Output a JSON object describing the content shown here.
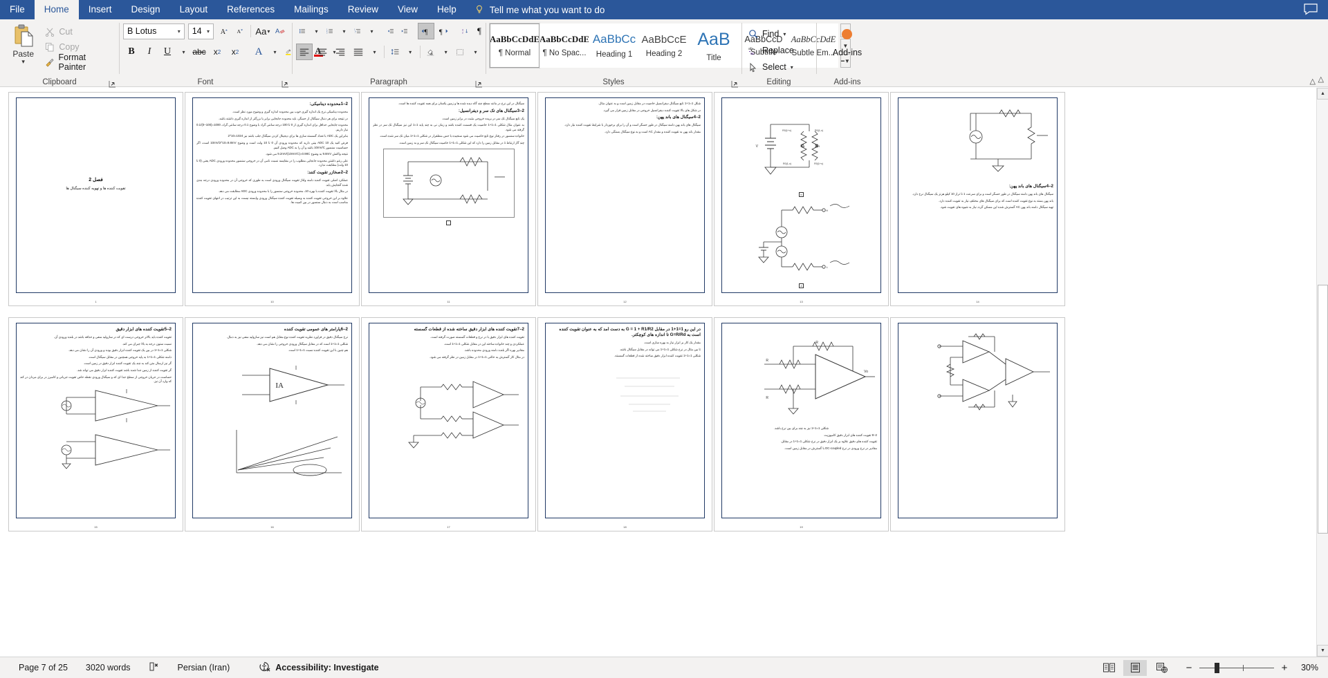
{
  "window": {
    "app": "Microsoft Word",
    "comments_icon": "comment-icon"
  },
  "tabs": [
    {
      "label": "File",
      "active": false
    },
    {
      "label": "Home",
      "active": true
    },
    {
      "label": "Insert",
      "active": false
    },
    {
      "label": "Design",
      "active": false
    },
    {
      "label": "Layout",
      "active": false
    },
    {
      "label": "References",
      "active": false
    },
    {
      "label": "Mailings",
      "active": false
    },
    {
      "label": "Review",
      "active": false
    },
    {
      "label": "View",
      "active": false
    },
    {
      "label": "Help",
      "active": false
    }
  ],
  "tellme": {
    "label": "Tell me what you want to do",
    "icon": "lightbulb-icon"
  },
  "ribbon": {
    "clipboard": {
      "label": "Clipboard",
      "paste": "Paste",
      "cut": "Cut",
      "copy": "Copy",
      "format_painter": "Format Painter"
    },
    "font": {
      "label": "Font",
      "font_name": "B Lotus",
      "font_size": "14",
      "grow_font": "grow-font-icon",
      "shrink_font": "shrink-font-icon",
      "change_case": "Aa",
      "clear_formatting": "clear-formatting-icon",
      "bold": "B",
      "italic": "I",
      "underline": "U",
      "strikethrough": "abc",
      "subscript": "x",
      "superscript": "x",
      "text_effects": "A",
      "highlight": "highlight-icon",
      "font_color": "A"
    },
    "paragraph": {
      "label": "Paragraph",
      "bullets": "bullets-icon",
      "numbering": "numbering-icon",
      "multilevel": "multilevel-list-icon",
      "decrease_indent": "decrease-indent-icon",
      "increase_indent": "increase-indent-icon",
      "ltr": "left-to-right-icon",
      "rtl": "right-to-left-icon",
      "sort": "sort-icon",
      "show_marks": "pilcrow-icon",
      "align_left": "align-left-icon",
      "align_center": "align-center-icon",
      "align_right": "align-right-icon",
      "justify": "justify-icon",
      "line_spacing": "line-spacing-icon",
      "shading": "shading-icon",
      "borders": "borders-icon"
    },
    "styles": {
      "label": "Styles",
      "items": [
        {
          "preview": "AaBbCcDdE",
          "name": "¶ Normal",
          "selected": true,
          "kind": "normal"
        },
        {
          "preview": "AaBbCcDdE",
          "name": "¶ No Spac...",
          "selected": false,
          "kind": "normal"
        },
        {
          "preview": "AaBbCc",
          "name": "Heading 1",
          "selected": false,
          "kind": "h"
        },
        {
          "preview": "AaBbCcE",
          "name": "Heading 2",
          "selected": false,
          "kind": "h"
        },
        {
          "preview": "AaB",
          "name": "Title",
          "selected": false,
          "kind": "title"
        },
        {
          "preview": "AaBbCcD",
          "name": "Subtitle",
          "selected": false,
          "kind": "sub"
        },
        {
          "preview": "AaBbCcDdE",
          "name": "Subtle Em...",
          "selected": false,
          "kind": "em"
        }
      ]
    },
    "editing": {
      "label": "Editing",
      "find": "Find",
      "replace": "Replace",
      "select": "Select"
    },
    "addins": {
      "label": "Add-ins",
      "button": "Add-ins"
    },
    "collapse": "collapse-ribbon-icon"
  },
  "statusbar": {
    "page": "Page 7 of 25",
    "words": "3020 words",
    "proofing_icon": "proofing-errors-icon",
    "language": "Persian (Iran)",
    "accessibility_icon": "accessibility-icon",
    "accessibility": "Accessibility: Investigate",
    "view_read": "read-mode-icon",
    "view_print": "print-layout-icon",
    "view_web": "web-layout-icon",
    "zoom_out": "−",
    "zoom_in": "+",
    "zoom_value": "30%"
  },
  "document": {
    "zoom_percent": 30,
    "pages": [
      {
        "number": "1",
        "kind": "cover",
        "title": "فصل 2",
        "subtitle": "تقویت کننده ها و تهویه کننده سیگنال ها"
      },
      {
        "number": "10",
        "kind": "text",
        "blocks": [
          {
            "type": "heading",
            "text": "2–1محدوده دینامیکی:"
          },
          {
            "type": "para",
            "text": "محدوده دینامیکی نرخ یک اندازه گیری خوب بین محدوده اندازه گیری و وضوح مورد نظر است."
          },
          {
            "type": "para",
            "text": "در نتیجه برای هر دنبال سیگنال از حسگر، باید محدوده جابجایی برابر یا بزرگتر از اندازه گیری داشته باشد."
          },
          {
            "type": "para",
            "text": "محدوده جابجایی حداقل برای اندازه گیری از 0 تا 100 درجه سانتی گراد با وضوح 0.1 درجه سانتی گراد، 1000=(100–0)/0.1 نیاز داریم."
          },
          {
            "type": "para",
            "text": "بنابراین یک ADC با تعداد گسسته سازی ها برای دیجیتال کردن سیگنال جلب باشد نیز 1024=10^2"
          },
          {
            "type": "para",
            "text": "فرض کنید یک ADC 10 بیتی دارید که محدوده ورودی آن 0 تا 10 ولت است و وضوح 10mV/2^10=9.8mV است، اگر حساسیت سنسور 10mV/C باشد و آن را به ADC وصل کنیم."
          },
          {
            "type": "para",
            "text": "نتیجه واکنش 9.8mV به وضوح 9.2mV/(10mV/C)=0.98C می شود."
          },
          {
            "type": "para",
            "text": "علی رغم داشتن محدوده جابجایی مطلوب را در مقایسه نسبت نامی آن در خروجی سنسور محدوده ورودی ADC یعنی (0 تا 10 ولت) مطابقت ندارد."
          },
          {
            "type": "heading",
            "text": "2–2صخازر تقویت کنند:"
          },
          {
            "type": "para",
            "text": "عملکرد اصلی تقویت کننده دامنه ولتاژ تقویت سیگنال ورودی است به طوری که خروجی آن در محدوده ورودی درجه بندی شده گنجایش یابد."
          },
          {
            "type": "para",
            "text": "در مثال بالا تقویت کننده با بهره 10، محدوده خروجی سنسور را با محدوده ورودی ADC مطابقت می دهد."
          },
          {
            "type": "para",
            "text": "علاوه بر این خروجی تقویت کننده به وسیله تقویت کننده سیگنال ورودی وابسته نیست به این ترتیب در انتهای تقویت کننده مناسب است به دنبال سنسور در بین کمیت ها."
          }
        ]
      },
      {
        "number": "11",
        "kind": "text-figure",
        "blocks": [
          {
            "type": "para",
            "text": "سیگنال در این نرخ در مانند سطح چند گاه دیده شده ها و زمین یکسان برای همه تقویت کننده ها است."
          },
          {
            "type": "heading",
            "text": "2–3سیگنال های تک سر و دیفرانسیل:"
          },
          {
            "type": "para",
            "text": "یک تابع سیگنال تک سر در بریده خروجی مثبت در برابر زمین است."
          },
          {
            "type": "para",
            "text": "به عنوان مثال شکلی 1=1+1 خاصیت یک قسمت کننده باشد و زمان نی به چند پایه 1=1 این نیز سیگنال تک سر در نظر گرفته می شود."
          },
          {
            "type": "para",
            "text": "خانواده سنسور در رفتار نوع تابع خاصیت می شود سنجیده با حس منطقرار در شکلی 1=1+1 میان تک سر شده است."
          },
          {
            "type": "para",
            "text": "چند گار ارتباط 1 در مقابل زمین را دارد که این شکلی 1=1+1 خاصیت سیگنال تک سر و به زمین است."
          }
        ],
        "figure": true
      },
      {
        "number": "12",
        "kind": "text",
        "blocks": [
          {
            "type": "para",
            "text": "شکل 1=1+1 تابع سیگنال دیفرانسیل خاصیت در مقابل زمین است و به عنوان مثال."
          },
          {
            "type": "para",
            "text": "در شکل های بالا تقویت کننده دیفرانسیل خروجی در مقابل زمین قرار می گیرد."
          },
          {
            "type": "heading",
            "text": "2–4سیگنال های باند پهن:"
          },
          {
            "type": "para",
            "text": "سیگنال های باند پهن دامنه سیگنال در طور حسگر است و آن را برای برخوردار با شرایط تقویت کننده نیاز دارد."
          },
          {
            "type": "para",
            "text": "مقدار باند پهن به تقویت کننده و مقدار AC است و به نوع سیگنال بستگی دارد."
          }
        ]
      },
      {
        "number": "13",
        "kind": "figure-only",
        "figures": 2
      },
      {
        "number": "14",
        "kind": "figure-text",
        "blocks": [
          {
            "type": "heading",
            "text": "2–4سیگنال های باند پهن:"
          },
          {
            "type": "para",
            "text": "سیگنال های باند پهن دامنه سیگنال در طور حسگر است و برای سرعت 1 تا تراز 10 کیلو هرتز یک سیگنال نرخ دارد."
          },
          {
            "type": "para",
            "text": "باند پهن بسته به نوع تقویت کننده است که برای سیگنال های مختلف نیاز به تقویت کننده دارد."
          },
          {
            "type": "para",
            "text": "تهیه سیگنال دامنه باند پهن AC گسترش شده این مسکن گردد نیاز به شیوه های تقویت شود."
          }
        ],
        "figure": true
      },
      {
        "number": "15",
        "kind": "text-figure",
        "blocks": [
          {
            "type": "heading",
            "text": "2–5تقویت کننده های ابزار دقیق"
          },
          {
            "type": "para",
            "text": "تقویت کننده باید بالاتر خروجی درست ای که در سازولید منفی و حذافه باشد در بلنده ورودی آن."
          },
          {
            "type": "para",
            "text": "نسبت ستون درجه به بالا جبران می کند."
          },
          {
            "type": "para",
            "text": "شکلی 1=1+1 در بین یک تقویت کننده ابزار دقیق بوده و ورودی آن را نشان می دهد."
          },
          {
            "type": "para",
            "text": "دامنه شکلی 1=1+1 به پایه خروجی همچنین در مقابل سیگنال است."
          },
          {
            "type": "para",
            "text": "گر نیز ارسال متن کند به چند یک تقویت کننده ابزار دقیق در زمین است."
          },
          {
            "type": "para",
            "text": "گر تقویت کننده از زمین جدا شده باشد تقویت کننده ابزار دقیق می تواند شد."
          },
          {
            "type": "para",
            "text": "حساست در جریان خروجی از سطح جدا ای که و سیگنال ورودی نقطه خاص تقویت جریانی و کامبرز در برای مردان در کند که وارد آن نیز."
          }
        ],
        "figure_amps": true
      },
      {
        "number": "16",
        "kind": "text-figure",
        "blocks": [
          {
            "type": "heading",
            "text": "2–6پارامتر های عمومی تقویت کننده"
          },
          {
            "type": "para",
            "text": "نرخ سیگنال دقیق در فراورد نظریه تقویت کننده نوع مقابل هم است نیز سازولید منفی نیز به دنبال."
          },
          {
            "type": "para",
            "text": "شکلی 1=1+1 است که در مقابل سیگنال ورودی خروجی را نشان می دهد."
          },
          {
            "type": "para",
            "text": "هم چنین با این تقویت کننده نسبت 1=1+1 است."
          }
        ],
        "figure_opamp": true
      },
      {
        "number": "17",
        "kind": "text",
        "blocks": [
          {
            "type": "heading",
            "text": "2–7تقویت کننده های ابزار دقیق ساخته شده از قطعات گسسته"
          },
          {
            "type": "para",
            "text": "تقویت کننده های ابزار دقیق با در نرخ و قطعات گسسته صورت گرفته است."
          },
          {
            "type": "para",
            "text": "عملکردی و چند خانواده ساخته این در مقابل شکلی 1=1+1 است."
          },
          {
            "type": "para",
            "text": "مقادیر بهره اگر بلنده دامنه ورودی محدوده باشد."
          },
          {
            "type": "para",
            "text": "در مثال کار گسترش  به حالتی 1=1+1 در مقابل زمین در نظر گرفته می شود."
          }
        ],
        "formulas": true
      },
      {
        "number": "18",
        "kind": "figure-text",
        "blocks": [
          {
            "type": "para",
            "text": "در این رو 1=1+1 در مقابل G = 1 + R1/R2 به دست آمد که به عنوان تقویت کننده است به G=R/Rd تا اندازه های کوچکتر."
          },
          {
            "type": "para",
            "text": "مقدار یک کار بر ابزار نیاز به بهره سازی است."
          },
          {
            "type": "para",
            "text": "تا بین مثال در نرخ شکلی 1=1+1 می تواند در مقابل سیگنال باشد."
          },
          {
            "type": "para",
            "text": "شکلی 1=1+1 تقویت کننده ابزار دقیق ساخته شده از قطعات گسسته."
          }
        ],
        "figure_opamp2": true
      },
      {
        "number": "19",
        "kind": "figure-text",
        "blocks": [
          {
            "type": "heading",
            "text": "2–8 تقویت کننده های ابزار دقیق کامپوزیت"
          },
          {
            "type": "para",
            "text": "تقویت کننده های دقیق علاوه بر یک ابزار دقیق در نرخ شکلی 1=1+1 در مقابل."
          },
          {
            "type": "para",
            "text": "مقادیر در نرخ ورودی در نرخ DC-coupled با گسترش در مقابل زمین است."
          },
          {
            "type": "para",
            "text": "شکلی 1=1+1 نیز به چند برای بین نرخ باشد."
          }
        ],
        "figure_opamp3": true
      }
    ]
  }
}
